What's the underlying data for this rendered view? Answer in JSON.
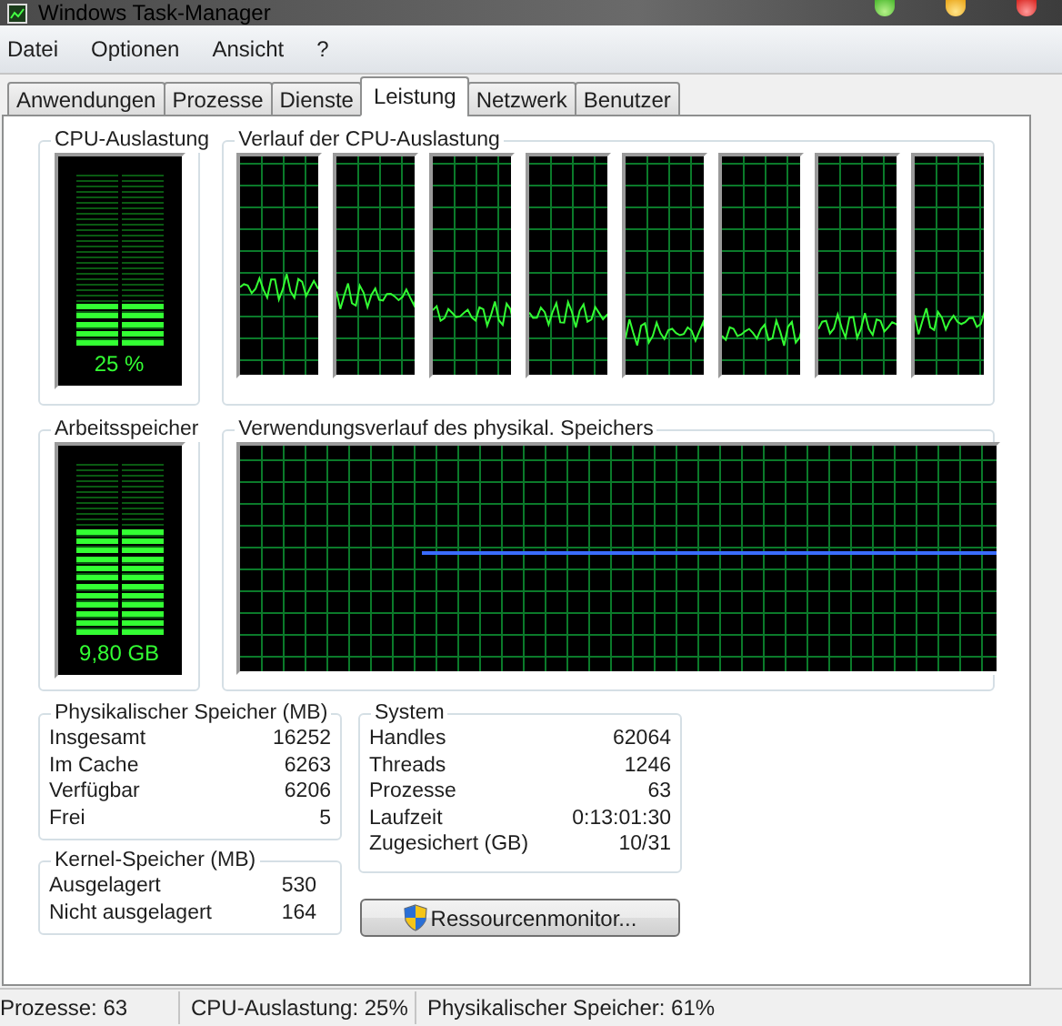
{
  "window": {
    "title": "Windows Task-Manager"
  },
  "menu": [
    "Datei",
    "Optionen",
    "Ansicht",
    "?"
  ],
  "tabs": [
    {
      "label": "Anwendungen",
      "selected": false
    },
    {
      "label": "Prozesse",
      "selected": false
    },
    {
      "label": "Dienste",
      "selected": false
    },
    {
      "label": "Leistung",
      "selected": true
    },
    {
      "label": "Netzwerk",
      "selected": false
    },
    {
      "label": "Benutzer",
      "selected": false
    }
  ],
  "cpu_usage": {
    "title": "CPU-Auslastung",
    "level": 0.25,
    "reading": "25 %"
  },
  "cpu_history": {
    "title": "Verlauf der CPU-Auslastung"
  },
  "memory": {
    "title": "Arbeitsspeicher",
    "level": 0.61,
    "reading": "9,80 GB"
  },
  "memory_history": {
    "title": "Verwendungsverlauf des physikal. Speichers"
  },
  "physical_memory": {
    "title": "Physikalischer Speicher (MB)",
    "rows": [
      {
        "label": "Insgesamt",
        "value": "16252"
      },
      {
        "label": "Im Cache",
        "value": "6263"
      },
      {
        "label": "Verfügbar",
        "value": "6206"
      },
      {
        "label": "Frei",
        "value": "5"
      }
    ]
  },
  "kernel_memory": {
    "title": "Kernel-Speicher (MB)",
    "rows": [
      {
        "label": "Ausgelagert",
        "value": "530"
      },
      {
        "label": "Nicht ausgelagert",
        "value": "164"
      }
    ]
  },
  "system": {
    "title": "System",
    "rows": [
      {
        "label": "Handles",
        "value": "62064"
      },
      {
        "label": "Threads",
        "value": "1246"
      },
      {
        "label": "Prozesse",
        "value": "63"
      },
      {
        "label": "Laufzeit",
        "value": "0:13:01:30"
      },
      {
        "label": "Zugesichert (GB)",
        "value": "10/31"
      }
    ]
  },
  "button": "Ressourcenmonitor...",
  "status_bar": [
    "Prozesse: 63",
    "CPU-Auslastung: 25%",
    "Physikalischer Speicher: 61%"
  ]
}
